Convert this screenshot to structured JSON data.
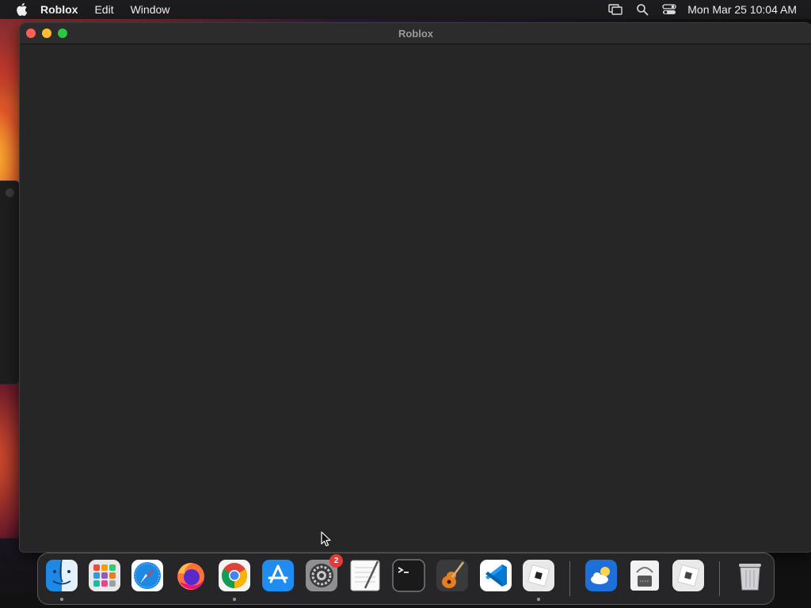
{
  "menubar": {
    "app_name": "Roblox",
    "items": [
      "Edit",
      "Window"
    ],
    "clock": "Mon Mar 25  10:04 AM"
  },
  "window": {
    "title": "Roblox"
  },
  "dock": {
    "apps": [
      {
        "name": "Finder",
        "icon": "finder-icon",
        "running": true
      },
      {
        "name": "Launchpad",
        "icon": "launchpad-icon",
        "running": false
      },
      {
        "name": "Safari",
        "icon": "safari-icon",
        "running": false
      },
      {
        "name": "Firefox",
        "icon": "firefox-icon",
        "running": false
      },
      {
        "name": "Google Chrome",
        "icon": "chrome-icon",
        "running": true
      },
      {
        "name": "App Store",
        "icon": "app-store-icon",
        "running": false
      },
      {
        "name": "System Settings",
        "icon": "settings-icon",
        "running": false,
        "badge": "2"
      },
      {
        "name": "TextEdit",
        "icon": "textedit-icon",
        "running": false
      },
      {
        "name": "Terminal",
        "icon": "terminal-icon",
        "running": false
      },
      {
        "name": "GarageBand",
        "icon": "garageband-icon",
        "running": false
      },
      {
        "name": "Visual Studio Code",
        "icon": "vscode-icon",
        "running": false
      },
      {
        "name": "Roblox",
        "icon": "roblox-icon",
        "running": true
      },
      {
        "name": "Weather",
        "icon": "weather-icon",
        "running": false
      },
      {
        "name": "Archive Utility",
        "icon": "archive-icon",
        "running": false
      },
      {
        "name": "Roblox Studio",
        "icon": "roblox-studio-icon",
        "running": false
      },
      {
        "name": "Trash",
        "icon": "trash-icon",
        "running": false
      }
    ]
  }
}
